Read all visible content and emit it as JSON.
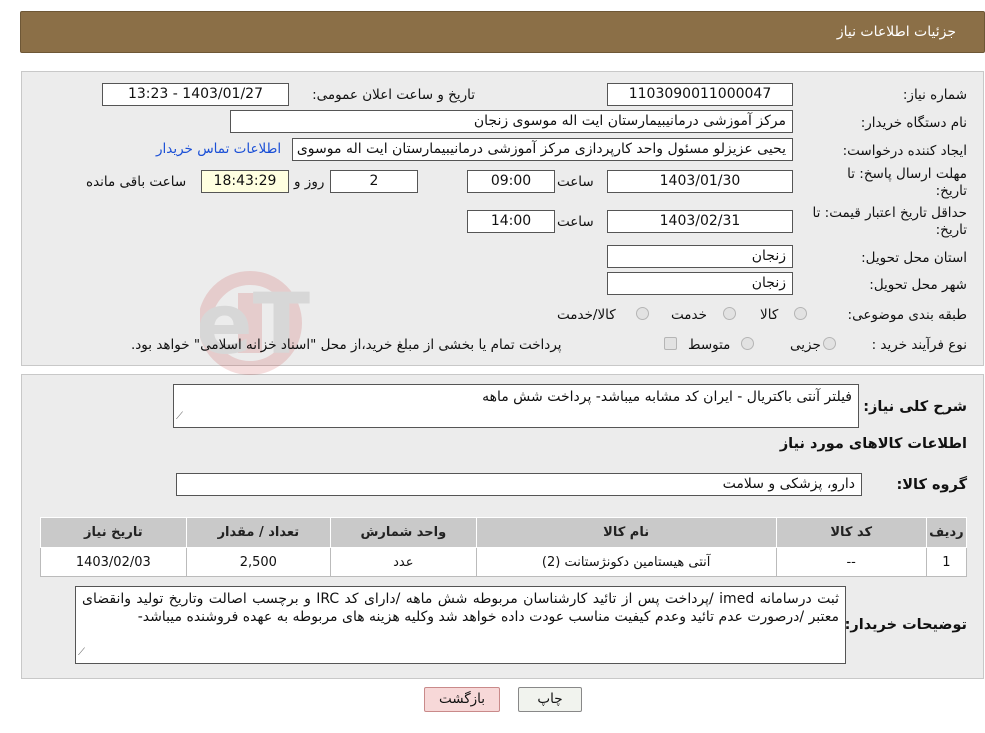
{
  "header": {
    "title": "جزئیات اطلاعات نیاز"
  },
  "form": {
    "need_number_label": "شماره نیاز:",
    "need_number": "1103090011000047",
    "announce_label": "تاریخ و ساعت اعلان عمومی:",
    "announce_value": "1403/01/27 - 13:23",
    "buyer_org_label": "نام دستگاه خریدار:",
    "buyer_org": "مرکز آموزشی درمانیبیمارستان ایت اله موسوی زنجان",
    "requester_label": "ایجاد کننده درخواست:",
    "requester": "یحیی عزیزلو مسئول واحد کارپردازی مرکز آموزشی درمانیبیمارستان ایت اله موسوی زنجان",
    "contact_link": "اطلاعات تماس خریدار",
    "reply_deadline_label": "مهلت ارسال پاسخ: تا تاریخ:",
    "reply_date": "1403/01/30",
    "time_label": "ساعت",
    "reply_time": "09:00",
    "days_value": "2",
    "days_label": "روز و",
    "remaining_time": "18:43:29",
    "remaining_label": "ساعت باقی مانده",
    "price_validity_label": "حداقل تاریخ اعتبار قیمت: تا تاریخ:",
    "price_date": "1403/02/31",
    "price_time": "14:00",
    "province_label": "استان محل تحویل:",
    "province": "زنجان",
    "city_label": "شهر محل تحویل:",
    "city": "زنجان",
    "category_label": "طبقه بندی موضوعی:",
    "category_options": [
      "کالا",
      "خدمت",
      "کالا/خدمت"
    ],
    "process_label": "نوع فرآیند خرید :",
    "process_options": [
      "جزیی",
      "متوسط"
    ],
    "process_note": "پرداخت تمام یا بخشی از مبلغ خرید،از محل \"اسناد خزانه اسلامی\" خواهد بود."
  },
  "details": {
    "summary_label": "شرح کلی نیاز:",
    "summary": "فیلتر آنتی باکتریال - ایران کد مشابه میباشد- پرداخت شش ماهه",
    "goods_info_title": "اطلاعات کالاهای مورد نیاز",
    "goods_group_label": "گروه کالا:",
    "goods_group": "دارو، پزشکی و سلامت",
    "table": {
      "headers": [
        "ردیف",
        "کد کالا",
        "نام کالا",
        "واحد شمارش",
        "تعداد / مقدار",
        "تاریخ نیاز"
      ],
      "rows": [
        [
          "1",
          "--",
          "آنتی هیستامین دکونژستانت (2)",
          "عدد",
          "2,500",
          "1403/02/03"
        ]
      ]
    },
    "buyer_notes_label": "توضیحات خریدار:",
    "buyer_notes": "ثبت درسامانه imed /پرداخت پس از تائید کارشناسان مربوطه  شش ماهه /دارای کد IRC  و برچسب اصالت وتاریخ تولید وانقضای معتبر /درصورت عدم تائید وعدم کیفیت مناسب عودت داده خواهد شد وکلیه هزینه های مربوطه به عهده فروشنده میباشد-"
  },
  "buttons": {
    "print": "چاپ",
    "back": "بازگشت"
  },
  "watermark_text": "AriaTender.neT"
}
